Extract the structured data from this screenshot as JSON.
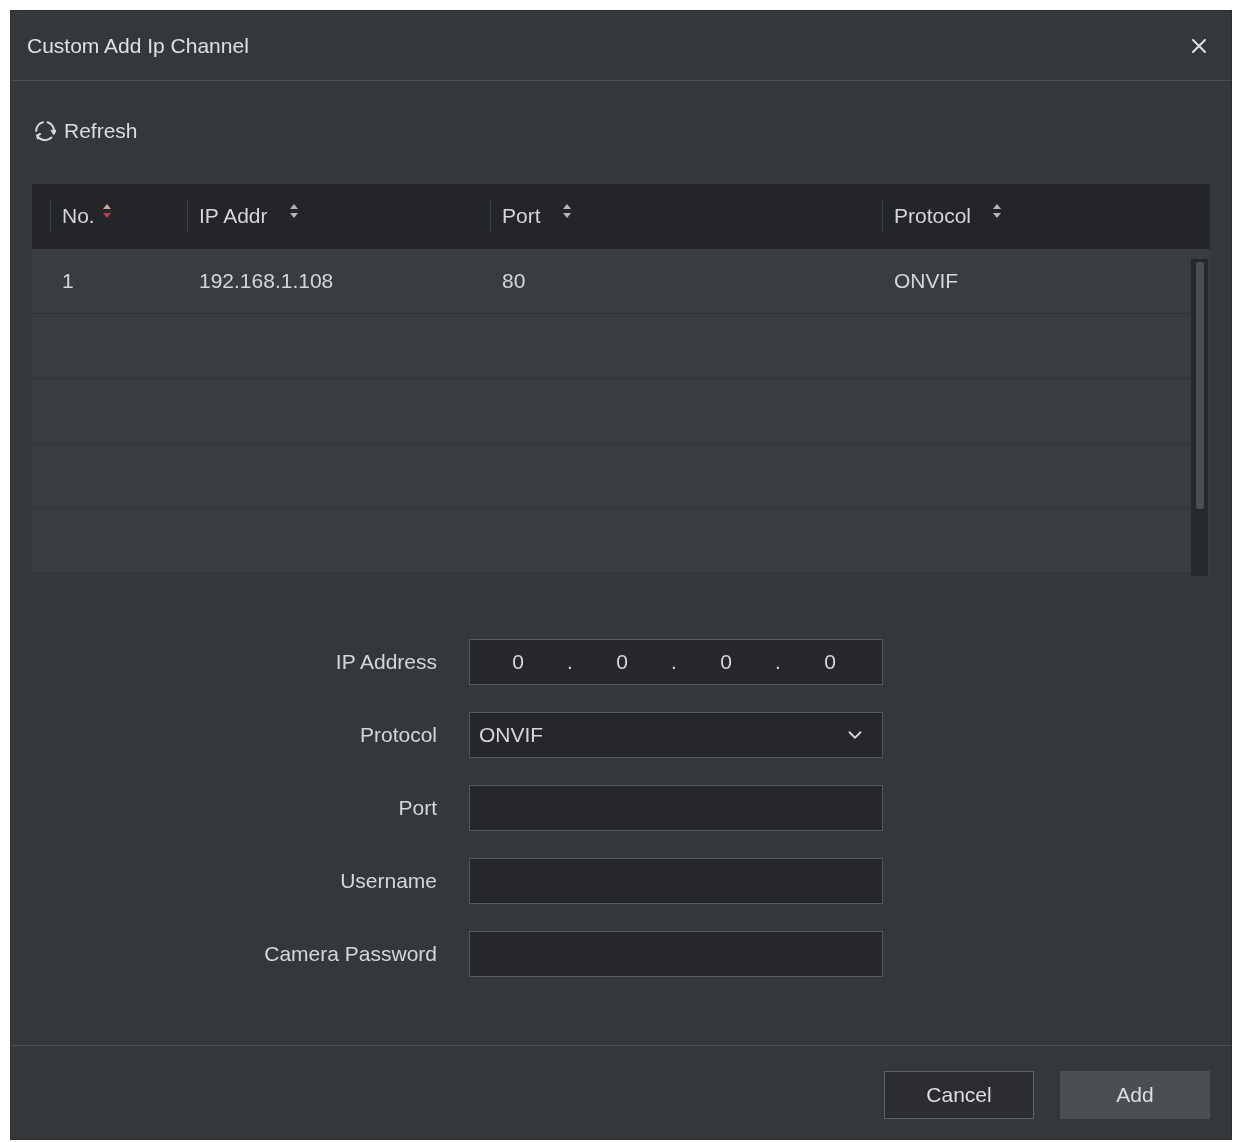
{
  "dialog": {
    "title": "Custom Add Ip Channel"
  },
  "toolbar": {
    "refresh_label": "Refresh"
  },
  "table": {
    "columns": [
      {
        "label": "No.",
        "sorted": true
      },
      {
        "label": "IP Addr",
        "sorted": false
      },
      {
        "label": "Port",
        "sorted": false
      },
      {
        "label": "Protocol",
        "sorted": false
      }
    ],
    "rows": [
      {
        "cells": [
          "1",
          "192.168.1.108",
          "80",
          "ONVIF"
        ]
      }
    ]
  },
  "form": {
    "fields": [
      {
        "kind": "ip",
        "label": "IP Address",
        "octets": [
          "0",
          "0",
          "0",
          "0"
        ],
        "separators": [
          ".",
          ".",
          "."
        ]
      },
      {
        "kind": "select",
        "label": "Protocol",
        "value": "ONVIF"
      },
      {
        "kind": "text",
        "label": "Port"
      },
      {
        "kind": "text",
        "label": "Username"
      },
      {
        "kind": "text",
        "label": "Camera Password"
      }
    ]
  },
  "buttons": [
    {
      "label": "Cancel",
      "kind": "secondary"
    },
    {
      "label": "Add",
      "kind": "primary"
    }
  ]
}
